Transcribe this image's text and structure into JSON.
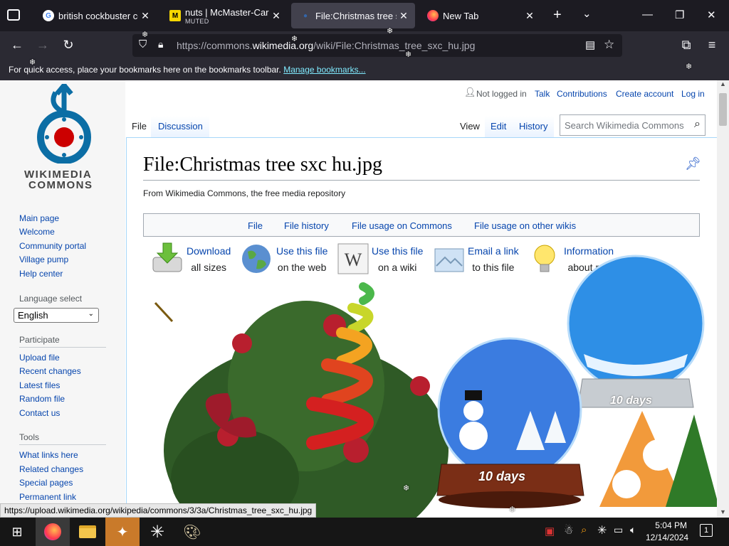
{
  "browser": {
    "tabs": [
      {
        "label": "british cockbuster com",
        "icon": "google-icon",
        "active": false
      },
      {
        "label": "nuts | McMaster-Carr",
        "sublabel": "MUTED",
        "icon": "mcmaster-icon",
        "active": false
      },
      {
        "label": "File:Christmas tree sxc",
        "icon": "wikimedia-icon",
        "active": true
      },
      {
        "label": "New Tab",
        "icon": "firefox-icon",
        "active": false
      }
    ],
    "url": {
      "prefix": "https://commons.",
      "domain": "wikimedia.org",
      "path": "/wiki/File:Christmas_tree_sxc_hu.jpg"
    },
    "bookmarks_hint": "For quick access, place your bookmarks here on the bookmarks toolbar.",
    "bookmarks_link": "Manage bookmarks...",
    "status_url": "https://upload.wikimedia.org/wikipedia/commons/3/3a/Christmas_tree_sxc_hu.jpg"
  },
  "site": {
    "logo_text_1": "WIKIMEDIA",
    "logo_text_2": "COMMONS",
    "user_links": {
      "not_logged_in": "Not logged in",
      "talk": "Talk",
      "contributions": "Contributions",
      "create_account": "Create account",
      "log_in": "Log in"
    },
    "page_tabs": {
      "file": "File",
      "discussion": "Discussion",
      "view": "View",
      "edit": "Edit",
      "history": "History"
    },
    "search_placeholder": "Search Wikimedia Commons",
    "sidebar": {
      "nav": [
        "Main page",
        "Welcome",
        "Community portal",
        "Village pump",
        "Help center"
      ],
      "language_heading": "Language select",
      "language_value": "English",
      "participate_heading": "Participate",
      "participate": [
        "Upload file",
        "Recent changes",
        "Latest files",
        "Random file",
        "Contact us"
      ],
      "tools_heading": "Tools",
      "tools": [
        "What links here",
        "Related changes",
        "Special pages",
        "Permanent link"
      ]
    },
    "title": "File:Christmas tree sxc hu.jpg",
    "tagline": "From Wikimedia Commons, the free media repository",
    "file_nav": [
      "File",
      "File history",
      "File usage on Commons",
      "File usage on other wikis"
    ],
    "tools": [
      {
        "line1": "Download",
        "line2": "all sizes"
      },
      {
        "line1": "Use this file",
        "line2": "on the web"
      },
      {
        "line1": "Use this file",
        "line2": "on a wiki"
      },
      {
        "line1": "Email a link",
        "line2": "to this file"
      },
      {
        "line1": "Information",
        "line2": "about reu"
      }
    ],
    "globe_text_1": "10 days",
    "globe_text_2": "10 days"
  },
  "taskbar": {
    "time": "5:04 PM",
    "date": "12/14/2024",
    "notification_count": "1"
  },
  "colors": {
    "link": "#0645ad",
    "chrome_dark": "#1c1b22",
    "chrome_mid": "#2b2a33",
    "active_tab": "#42414d"
  }
}
